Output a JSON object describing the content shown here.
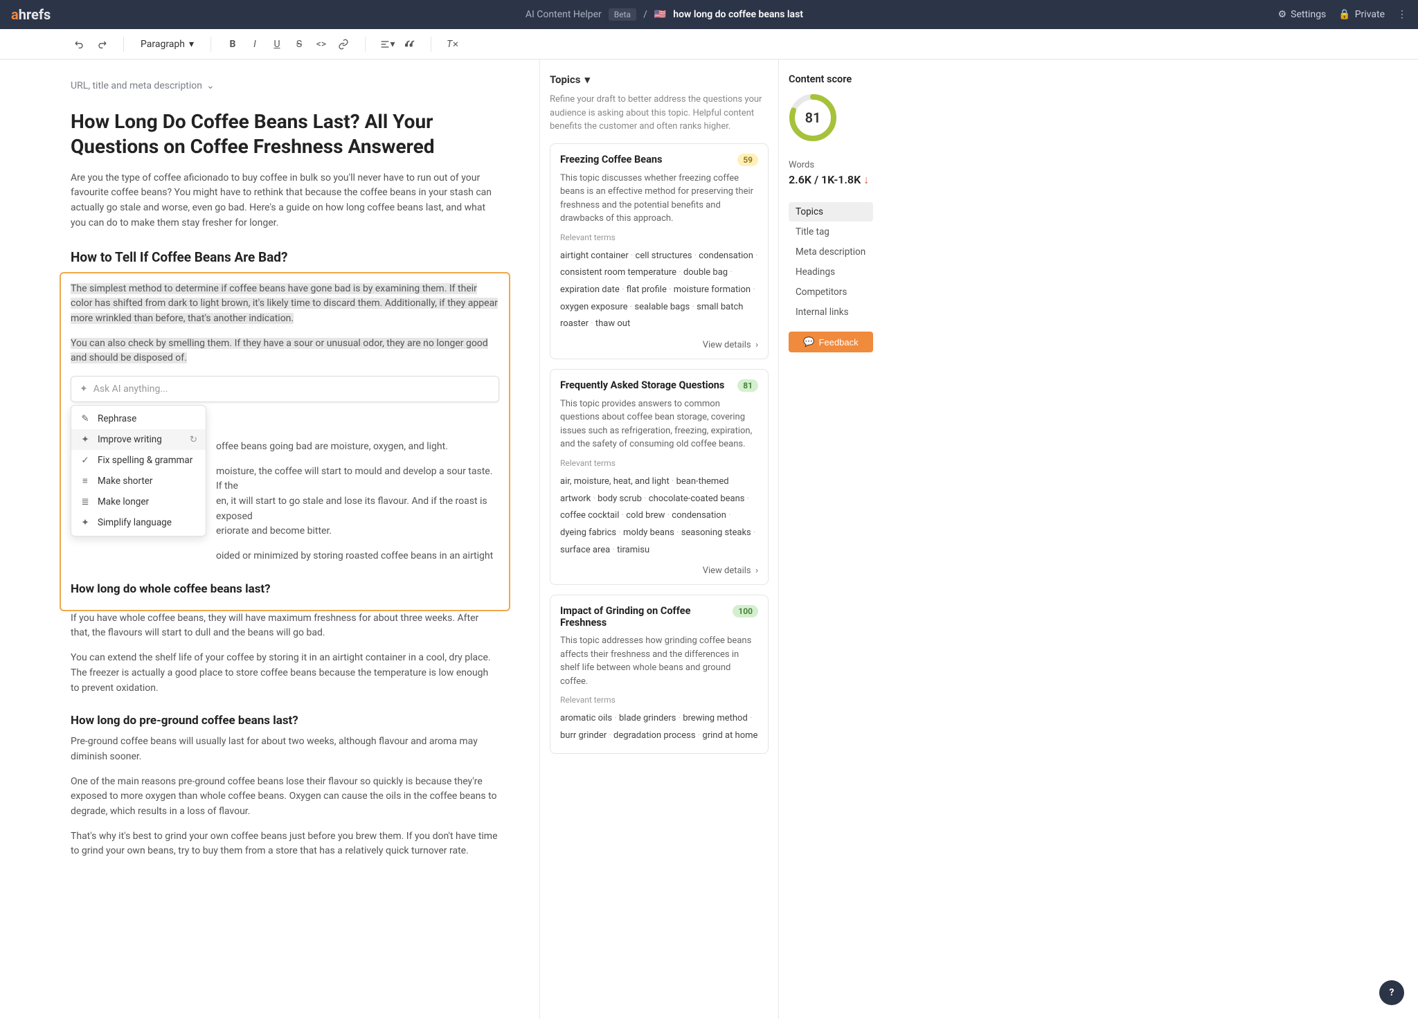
{
  "topbar": {
    "app": "AI Content Helper",
    "beta": "Beta",
    "keyword": "how long do coffee beans last",
    "settings": "Settings",
    "private": "Private"
  },
  "toolbar": {
    "block_label": "Paragraph"
  },
  "editor": {
    "meta_toggle": "URL, title and meta description",
    "h1": "How Long Do Coffee Beans Last? All Your Questions on Coffee Freshness Answered",
    "intro": "Are you the type of coffee aficionado to buy coffee in bulk so you'll never have to run out of your favourite coffee beans? You might have to rethink that because the coffee beans in your stash can actually go stale and worse, even go bad. Here's a guide on how long coffee beans last, and what you can do to make them stay fresher for longer.",
    "h2_1": "How to Tell If Coffee Beans Are Bad?",
    "p_hl1": "The simplest method to determine if coffee beans have gone bad is by examining them. If their color has shifted from dark to light brown, it's likely time to discard them. Additionally, if they appear more wrinkled than before, that's another indication.",
    "p_hl2": "You can also check by smelling them. If they have a sour or unusual odor, they are no longer good and should be disposed of.",
    "ai_placeholder": "Ask AI anything...",
    "ai_menu": {
      "rephrase": "Rephrase",
      "improve": "Improve writing",
      "fix": "Fix spelling & grammar",
      "shorter": "Make shorter",
      "longer": "Make longer",
      "simplify": "Simplify language"
    },
    "p_causes_tail": "offee beans going bad are moisture, oxygen, and light.",
    "p_moisture": "moisture, the coffee will start to mould and develop a sour taste. If the",
    "p_moisture2": "en, it will start to go stale and lose its flavour. And if the roast is exposed",
    "p_moisture3": "eriorate and become bitter.",
    "p_avoided": "oided or minimized by storing roasted coffee beans in an airtight",
    "h2_2": "How long do whole coffee beans last?",
    "p_whole1": "If you have whole coffee beans, they will have maximum freshness for about three weeks. After that, the flavours will start to dull and the beans will go bad.",
    "p_whole2": "You can extend the shelf life of your coffee by storing it in an airtight container in a cool, dry place. The freezer is actually a good place to store coffee beans because the temperature is low enough to prevent oxidation.",
    "h2_3": "How long do pre-ground coffee beans last?",
    "p_pre1": "Pre-ground coffee beans will usually last for about two weeks, although flavour and aroma may diminish sooner.",
    "p_pre2": "One of the main reasons pre-ground coffee beans lose their flavour so quickly is because they're exposed to more oxygen than whole coffee beans. Oxygen can cause the oils in the coffee beans to degrade, which results in a loss of flavour.",
    "p_pre3": "That's why it's best to grind your own coffee beans just before you brew them. If you don't have time to grind your own beans, try to buy them from a store that has a relatively quick turnover rate."
  },
  "topics": {
    "header": "Topics",
    "sub": "Refine your draft to better address the questions your audience is asking about this topic. Helpful content benefits the customer and often ranks higher.",
    "cards": [
      {
        "title": "Freezing Coffee Beans",
        "score": "59",
        "pill": "y",
        "desc": "This topic discusses whether freezing coffee beans is an effective method for preserving their freshness and the potential benefits and drawbacks of this approach.",
        "rel": "Relevant terms",
        "terms": [
          "airtight container",
          "cell structures",
          "condensation",
          "consistent room temperature",
          "double bag",
          "expiration date",
          "flat profile",
          "moisture formation",
          "oxygen exposure",
          "sealable bags",
          "small batch roaster",
          "thaw out"
        ],
        "view": "View details"
      },
      {
        "title": "Frequently Asked Storage Questions",
        "score": "81",
        "pill": "g",
        "desc": "This topic provides answers to common questions about coffee bean storage, covering issues such as refrigeration, freezing, expiration, and the safety of consuming old coffee beans.",
        "rel": "Relevant terms",
        "terms": [
          "air, moisture, heat, and light",
          "bean-themed artwork",
          "body scrub",
          "chocolate-coated beans",
          "coffee cocktail",
          "cold brew",
          "condensation",
          "dyeing fabrics",
          "moldy beans",
          "seasoning steaks",
          "surface area",
          "tiramisu"
        ],
        "view": "View details"
      },
      {
        "title": "Impact of Grinding on Coffee Freshness",
        "score": "100",
        "pill": "g",
        "desc": "This topic addresses how grinding coffee beans affects their freshness and the differences in shelf life between whole beans and ground coffee.",
        "rel": "Relevant terms",
        "terms": [
          "aromatic oils",
          "blade grinders",
          "brewing method",
          "burr grinder",
          "degradation process",
          "grind at home"
        ],
        "view": ""
      }
    ]
  },
  "score": {
    "title": "Content score",
    "value": "81",
    "words_label": "Words",
    "words_value": "2.6K / 1K-1.8K",
    "nav": [
      "Topics",
      "Title tag",
      "Meta description",
      "Headings",
      "Competitors",
      "Internal links"
    ],
    "feedback": "Feedback"
  },
  "colors": {
    "accent": "#f0873d",
    "ring": "#a6c23a"
  }
}
